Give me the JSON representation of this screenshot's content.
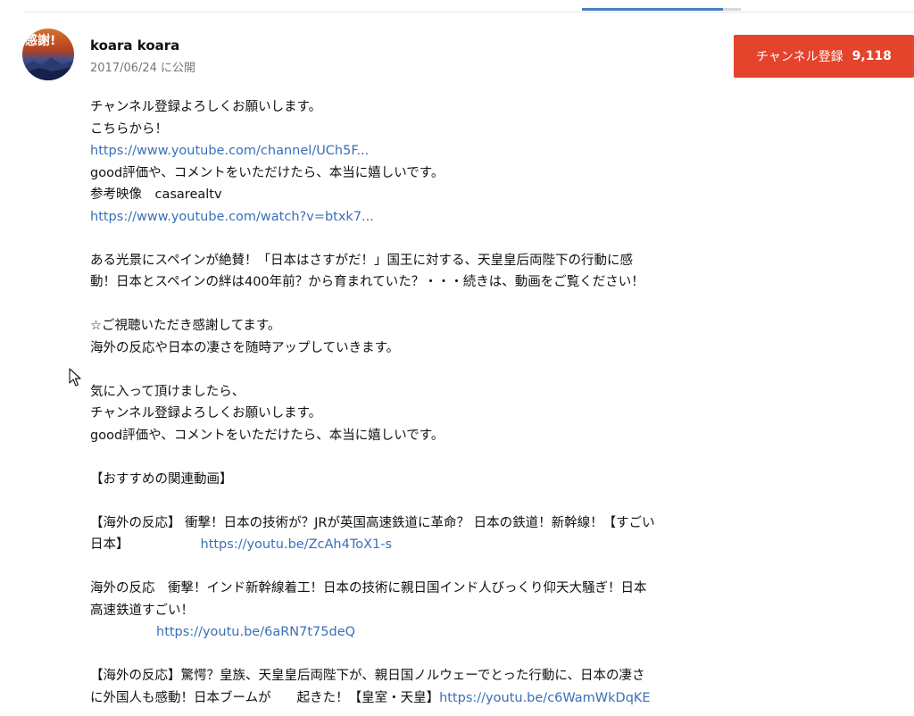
{
  "progress": {
    "fraction": 0.89
  },
  "channel": {
    "avatar_text": "感謝!",
    "name": "koara koara",
    "published": "2017/06/24 に公開"
  },
  "subscribe": {
    "label": "チャンネル登録",
    "count": "9,118",
    "color": "#e4432c"
  },
  "description": {
    "line1": "チャンネル登録よろしくお願いします。",
    "line2": "こちらから！",
    "link1": "https://www.youtube.com/channel/UCh5F...",
    "line3": "good評価や、コメントをいただけたら、本当に嬉しいです。",
    "line4": "参考映像　casarealtv",
    "link2": "https://www.youtube.com/watch?v=btxk7...",
    "para1a": "ある光景にスペインが絶賛！「日本はさすがだ！」国王に対する、天皇皇后両陛下の行動に感",
    "para1b": "動！日本とスペインの絆は400年前？から育まれていた？・・・続きは、動画をご覧ください！",
    "line5": "☆ご視聴いただき感謝してます。",
    "line6": "海外の反応や日本の凄さを随時アップしていきます。",
    "line7": "気に入って頂けましたら、",
    "line8": "チャンネル登録よろしくお願いします。",
    "line9": "good評価や、コメントをいただけたら、本当に嬉しいです。",
    "rec_heading": "【おすすめの関連動画】",
    "rec1a": "【海外の反応】 衝撃！日本の技術が？JRが英国高速鉄道に革命？ 日本の鉄道！新幹線！【すごい",
    "rec1b": "日本】",
    "rec1_link": "https://youtu.be/ZcAh4ToX1-s",
    "rec2a": "海外の反応　衝撃！インド新幹線着工！日本の技術に親日国インド人びっくり仰天大騒ぎ！日本",
    "rec2b": "高速鉄道すごい！",
    "rec2_link": "https://youtu.be/6aRN7t75deQ",
    "rec3a": "【海外の反応】驚愕？皇族、天皇皇后両陛下が、親日国ノルウェーでとった行動に、日本の凄さ",
    "rec3b": "に外国人も感動！日本ブームが　　起きた！【皇室・天皇】",
    "rec3_link": "https://youtu.be/c6WamWkDqKE"
  },
  "colors": {
    "link": "#3a6fb8",
    "meta": "#777777"
  },
  "icons": {
    "cursor": "mouse-pointer-icon"
  }
}
